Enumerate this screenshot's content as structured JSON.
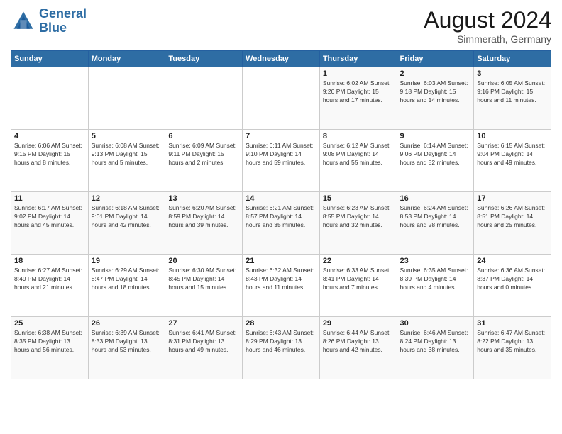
{
  "logo": {
    "line1": "General",
    "line2": "Blue"
  },
  "title": "August 2024",
  "location": "Simmerath, Germany",
  "days_of_week": [
    "Sunday",
    "Monday",
    "Tuesday",
    "Wednesday",
    "Thursday",
    "Friday",
    "Saturday"
  ],
  "weeks": [
    [
      {
        "day": "",
        "info": ""
      },
      {
        "day": "",
        "info": ""
      },
      {
        "day": "",
        "info": ""
      },
      {
        "day": "",
        "info": ""
      },
      {
        "day": "1",
        "info": "Sunrise: 6:02 AM\nSunset: 9:20 PM\nDaylight: 15 hours\nand 17 minutes."
      },
      {
        "day": "2",
        "info": "Sunrise: 6:03 AM\nSunset: 9:18 PM\nDaylight: 15 hours\nand 14 minutes."
      },
      {
        "day": "3",
        "info": "Sunrise: 6:05 AM\nSunset: 9:16 PM\nDaylight: 15 hours\nand 11 minutes."
      }
    ],
    [
      {
        "day": "4",
        "info": "Sunrise: 6:06 AM\nSunset: 9:15 PM\nDaylight: 15 hours\nand 8 minutes."
      },
      {
        "day": "5",
        "info": "Sunrise: 6:08 AM\nSunset: 9:13 PM\nDaylight: 15 hours\nand 5 minutes."
      },
      {
        "day": "6",
        "info": "Sunrise: 6:09 AM\nSunset: 9:11 PM\nDaylight: 15 hours\nand 2 minutes."
      },
      {
        "day": "7",
        "info": "Sunrise: 6:11 AM\nSunset: 9:10 PM\nDaylight: 14 hours\nand 59 minutes."
      },
      {
        "day": "8",
        "info": "Sunrise: 6:12 AM\nSunset: 9:08 PM\nDaylight: 14 hours\nand 55 minutes."
      },
      {
        "day": "9",
        "info": "Sunrise: 6:14 AM\nSunset: 9:06 PM\nDaylight: 14 hours\nand 52 minutes."
      },
      {
        "day": "10",
        "info": "Sunrise: 6:15 AM\nSunset: 9:04 PM\nDaylight: 14 hours\nand 49 minutes."
      }
    ],
    [
      {
        "day": "11",
        "info": "Sunrise: 6:17 AM\nSunset: 9:02 PM\nDaylight: 14 hours\nand 45 minutes."
      },
      {
        "day": "12",
        "info": "Sunrise: 6:18 AM\nSunset: 9:01 PM\nDaylight: 14 hours\nand 42 minutes."
      },
      {
        "day": "13",
        "info": "Sunrise: 6:20 AM\nSunset: 8:59 PM\nDaylight: 14 hours\nand 39 minutes."
      },
      {
        "day": "14",
        "info": "Sunrise: 6:21 AM\nSunset: 8:57 PM\nDaylight: 14 hours\nand 35 minutes."
      },
      {
        "day": "15",
        "info": "Sunrise: 6:23 AM\nSunset: 8:55 PM\nDaylight: 14 hours\nand 32 minutes."
      },
      {
        "day": "16",
        "info": "Sunrise: 6:24 AM\nSunset: 8:53 PM\nDaylight: 14 hours\nand 28 minutes."
      },
      {
        "day": "17",
        "info": "Sunrise: 6:26 AM\nSunset: 8:51 PM\nDaylight: 14 hours\nand 25 minutes."
      }
    ],
    [
      {
        "day": "18",
        "info": "Sunrise: 6:27 AM\nSunset: 8:49 PM\nDaylight: 14 hours\nand 21 minutes."
      },
      {
        "day": "19",
        "info": "Sunrise: 6:29 AM\nSunset: 8:47 PM\nDaylight: 14 hours\nand 18 minutes."
      },
      {
        "day": "20",
        "info": "Sunrise: 6:30 AM\nSunset: 8:45 PM\nDaylight: 14 hours\nand 15 minutes."
      },
      {
        "day": "21",
        "info": "Sunrise: 6:32 AM\nSunset: 8:43 PM\nDaylight: 14 hours\nand 11 minutes."
      },
      {
        "day": "22",
        "info": "Sunrise: 6:33 AM\nSunset: 8:41 PM\nDaylight: 14 hours\nand 7 minutes."
      },
      {
        "day": "23",
        "info": "Sunrise: 6:35 AM\nSunset: 8:39 PM\nDaylight: 14 hours\nand 4 minutes."
      },
      {
        "day": "24",
        "info": "Sunrise: 6:36 AM\nSunset: 8:37 PM\nDaylight: 14 hours\nand 0 minutes."
      }
    ],
    [
      {
        "day": "25",
        "info": "Sunrise: 6:38 AM\nSunset: 8:35 PM\nDaylight: 13 hours\nand 56 minutes."
      },
      {
        "day": "26",
        "info": "Sunrise: 6:39 AM\nSunset: 8:33 PM\nDaylight: 13 hours\nand 53 minutes."
      },
      {
        "day": "27",
        "info": "Sunrise: 6:41 AM\nSunset: 8:31 PM\nDaylight: 13 hours\nand 49 minutes."
      },
      {
        "day": "28",
        "info": "Sunrise: 6:43 AM\nSunset: 8:29 PM\nDaylight: 13 hours\nand 46 minutes."
      },
      {
        "day": "29",
        "info": "Sunrise: 6:44 AM\nSunset: 8:26 PM\nDaylight: 13 hours\nand 42 minutes."
      },
      {
        "day": "30",
        "info": "Sunrise: 6:46 AM\nSunset: 8:24 PM\nDaylight: 13 hours\nand 38 minutes."
      },
      {
        "day": "31",
        "info": "Sunrise: 6:47 AM\nSunset: 8:22 PM\nDaylight: 13 hours\nand 35 minutes."
      }
    ]
  ]
}
